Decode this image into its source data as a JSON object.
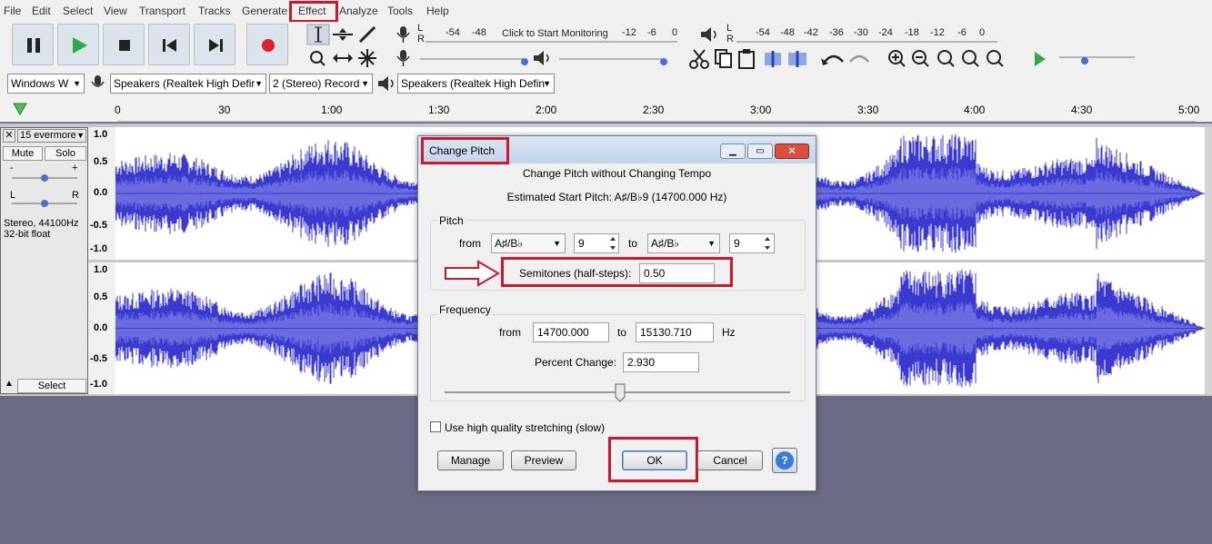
{
  "menu": {
    "items": [
      "File",
      "Edit",
      "Select",
      "View",
      "Transport",
      "Tracks",
      "Generate",
      "Effect",
      "Analyze",
      "Tools",
      "Help"
    ]
  },
  "transport": {
    "pause_icon": "pause-icon",
    "play_icon": "play-icon",
    "stop_icon": "stop-icon",
    "skip_start_icon": "skip-start-icon",
    "skip_end_icon": "skip-end-icon",
    "record_icon": "record-icon"
  },
  "meters": {
    "record_ticks": [
      "-54",
      "-48",
      "-12",
      "-6",
      "0"
    ],
    "monitor_text": "Click to Start Monitoring",
    "play_ticks": [
      "-54",
      "-48",
      "-42",
      "-36",
      "-30",
      "-24",
      "-18",
      "-12",
      "-6",
      "0"
    ],
    "lr_l": "L",
    "lr_r": "R"
  },
  "device": {
    "host": "Windows W",
    "playback": "Speakers (Realtek High Defir",
    "channels": "2 (Stereo) Record",
    "output": "Speakers (Realtek High Defin"
  },
  "ruler": {
    "ticks": [
      "0",
      "30",
      "1:00",
      "1:30",
      "2:00",
      "2:30",
      "3:00",
      "3:30",
      "4:00",
      "4:30",
      "5:00"
    ]
  },
  "track": {
    "name": "15 evermore",
    "mute": "Mute",
    "solo": "Solo",
    "gain_minus": "-",
    "gain_plus": "+",
    "pan_l": "L",
    "pan_r": "R",
    "info1": "Stereo, 44100Hz",
    "info2": "32-bit float",
    "select": "Select",
    "scale": [
      "1.0",
      "0.5",
      "0.0",
      "-0.5",
      "-1.0"
    ]
  },
  "dialog": {
    "title": "Change Pitch",
    "heading": "Change Pitch without Changing Tempo",
    "estimated": "Estimated Start Pitch: A♯/B♭9 (14700.000 Hz)",
    "pitch_group": "Pitch",
    "from_label": "from",
    "from_note": "A♯/B♭",
    "from_octave": "9",
    "to_label": "to",
    "to_note": "A♯/B♭",
    "to_octave": "9",
    "semitones_label": "Semitones (half-steps):",
    "semitones_value": "0.50",
    "freq_group": "Frequency",
    "freq_from_label": "from",
    "freq_from": "14700.000",
    "freq_to_label": "to",
    "freq_to": "15130.710",
    "freq_unit": "Hz",
    "percent_label": "Percent Change:",
    "percent_value": "2.930",
    "slider_level": 0.5,
    "hq_label": "Use high quality stretching (slow)",
    "manage": "Manage",
    "preview": "Preview",
    "ok": "OK",
    "cancel": "Cancel",
    "help": "?"
  },
  "colors": {
    "highlight": "#d0162b",
    "waveform": "#3a3ad0",
    "waveform_inner": "#6b6be0",
    "background": "#6b6b85"
  }
}
